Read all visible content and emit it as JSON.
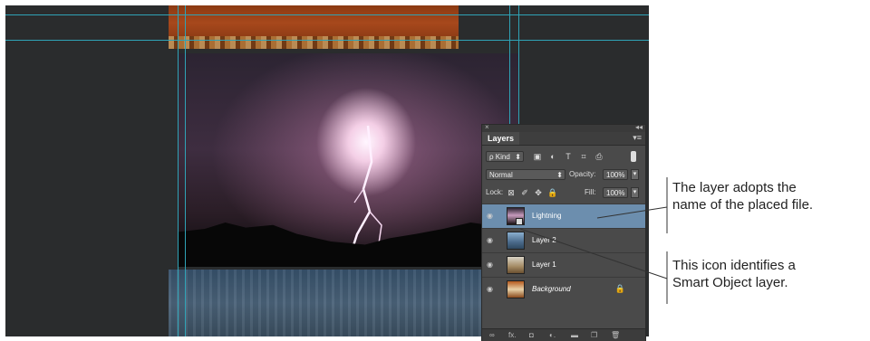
{
  "layers_panel": {
    "close_glyph": "×",
    "collapse_glyph": "◂◂",
    "tab_label": "Layers",
    "menu_glyph": "▾≡",
    "filter": {
      "value": "ρ Kind",
      "arrow": "⬍"
    },
    "filter_icons": [
      "image-filter-icon",
      "adjustment-filter-icon",
      "type-filter-icon",
      "shape-filter-icon",
      "smart-object-filter-icon"
    ],
    "filter_glyphs": [
      "▣",
      "◐",
      "T",
      "⌗",
      "⎙"
    ],
    "blend_mode": {
      "value": "Normal",
      "arrow": "⬍"
    },
    "opacity": {
      "label": "Opacity:",
      "value": "100%"
    },
    "lock": {
      "label": "Lock:"
    },
    "lock_glyphs": [
      "⊠",
      "✐",
      "✥",
      "🔒"
    ],
    "fill": {
      "label": "Fill:",
      "value": "100%"
    },
    "stepper_glyph": "▾",
    "eye_glyph": "◉",
    "lock_layer_glyph": "🔒",
    "layers": [
      {
        "name": "Lightning",
        "selected": true,
        "smart_object": true,
        "italic": false
      },
      {
        "name": "Layer 2",
        "selected": false,
        "smart_object": false,
        "italic": false
      },
      {
        "name": "Layer 1",
        "selected": false,
        "smart_object": false,
        "italic": false
      },
      {
        "name": "Background",
        "selected": false,
        "smart_object": false,
        "italic": true,
        "locked": true
      }
    ],
    "bottom_icons": [
      "link-icon",
      "fx-icon",
      "mask-icon",
      "adjustment-icon",
      "folder-icon",
      "new-layer-icon",
      "trash-icon"
    ],
    "bottom_glyphs": [
      "∞",
      "fx.",
      "◘",
      "◐.",
      "▬",
      "❐",
      "🗑"
    ]
  },
  "callouts": {
    "first": {
      "line1": "The layer adopts the",
      "line2": "name of the placed file."
    },
    "second": {
      "line1": "This icon identifies a",
      "line2": "Smart Object layer."
    }
  },
  "colors": {
    "guide": "#2fa3b6",
    "selected_layer": "#6c8eae",
    "panel_bg": "#4a4a4a",
    "canvas_bg": "#2a2c2d"
  }
}
